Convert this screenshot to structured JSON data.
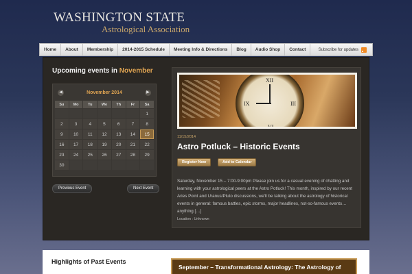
{
  "logo": {
    "main": "WASHINGTON STATE",
    "sub": "Astrological Association"
  },
  "nav": {
    "items": [
      "Home",
      "About",
      "Membership",
      "2014-2015 Schedule",
      "Meeting Info & Directions",
      "Blog",
      "Audio Shop",
      "Contact"
    ],
    "subscribe": "Subscribe for updates",
    "rss_icon": "rss-icon"
  },
  "upcoming": {
    "label": "Upcoming events in",
    "month": "November"
  },
  "calendar": {
    "title": "November 2014",
    "prev_icon": "chevron-left-icon",
    "next_icon": "chevron-right-icon",
    "dow": [
      "Su",
      "Mo",
      "Tu",
      "We",
      "Th",
      "Fr",
      "Sa"
    ],
    "days": [
      "",
      "",
      "",
      "",
      "",
      "",
      "1",
      "2",
      "3",
      "4",
      "5",
      "6",
      "7",
      "8",
      "9",
      "10",
      "11",
      "12",
      "13",
      "14",
      "15",
      "16",
      "17",
      "18",
      "19",
      "20",
      "21",
      "22",
      "23",
      "24",
      "25",
      "26",
      "27",
      "28",
      "29",
      "30",
      "",
      "",
      "",
      "",
      "",
      ""
    ],
    "highlighted_day": "15"
  },
  "buttons": {
    "prev_event": "Previous Event",
    "next_event": "Next Event"
  },
  "event": {
    "date": "11/15/2014",
    "title": "Astro Potluck – Historic Events",
    "register": "Register Now",
    "add_calendar": "Add to Calendar",
    "description": "Saturday, November 15 – 7:00-9:00pm Please join us for a casual evening of chatting and learning with your astrological peers at the Astro Potluck! This month, inspired by our recent Aries Point and Uranus/Pluto discussions, we'll be talking about the astrology of historical events in general: famous battles, epic storms, major headlines, not-so-famous events… anything […]",
    "location": "Location : Unknown"
  },
  "past": {
    "heading": "Highlights of Past Events",
    "banner": "September – Transformational Astrology: The Astrology of"
  },
  "colors": {
    "accent": "#e1a552",
    "gold_button": "#b8945c",
    "highlight_day": "#8a6a3c"
  }
}
